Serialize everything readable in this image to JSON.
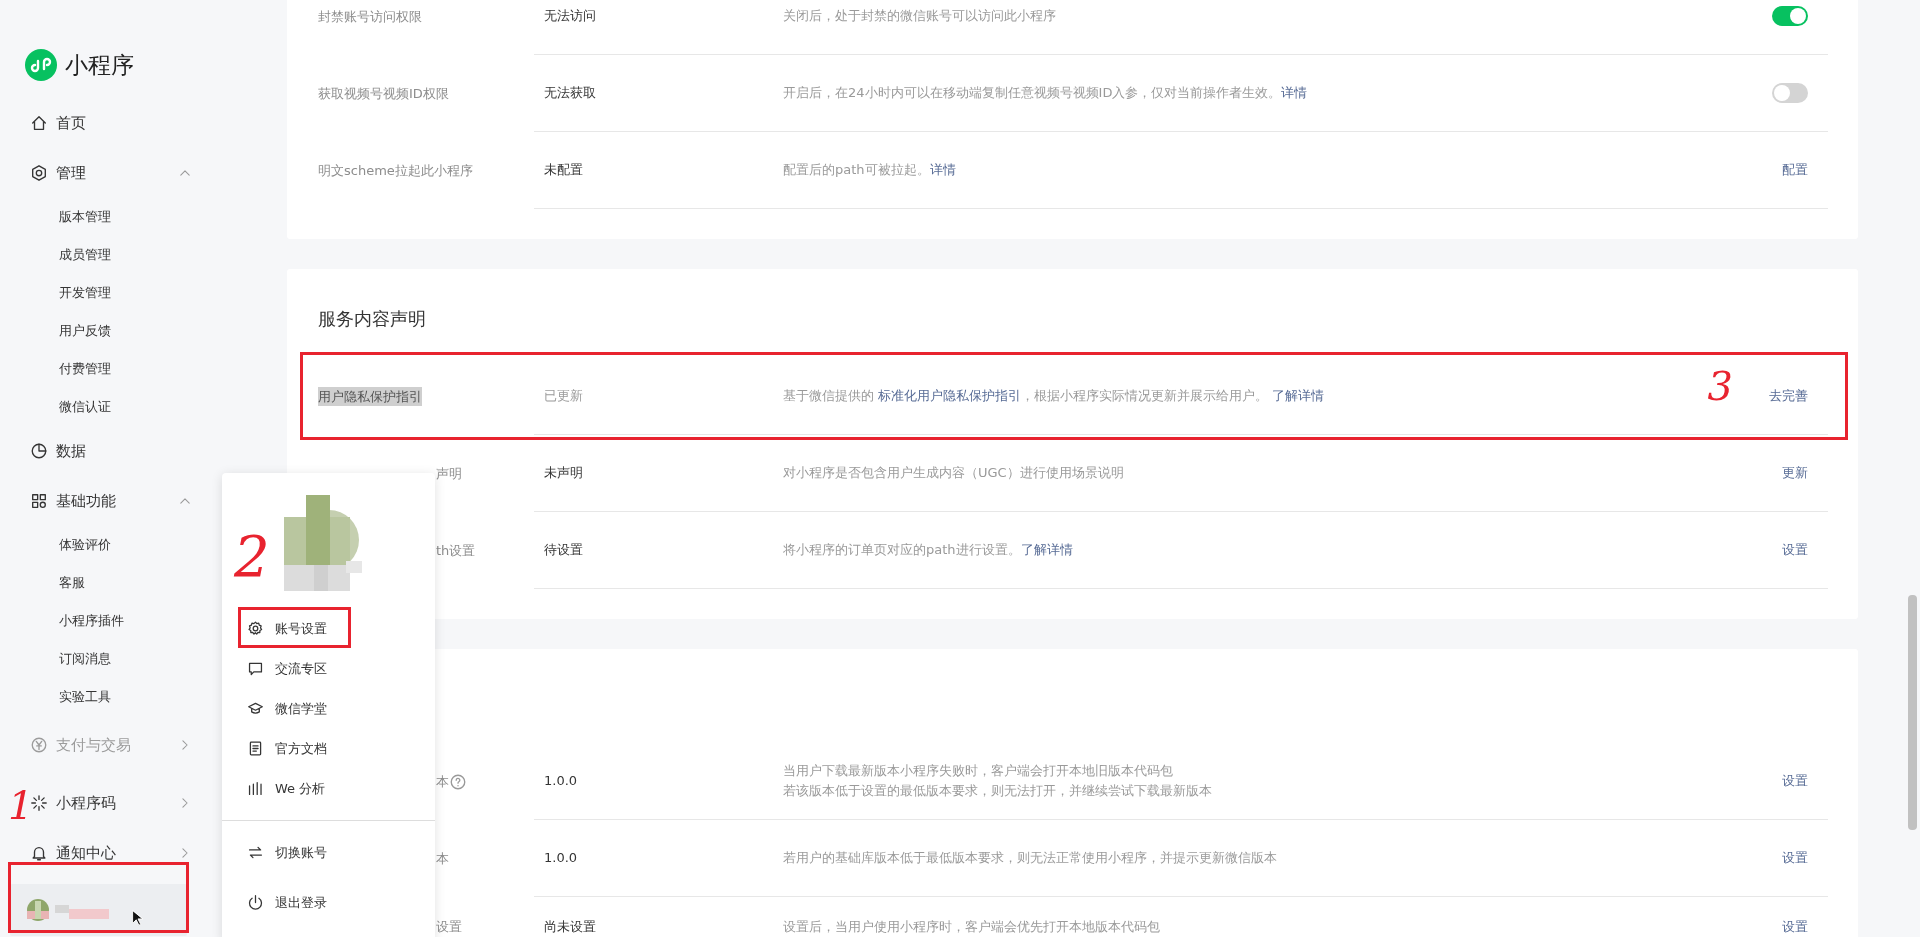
{
  "sidebar": {
    "logo": "小程序",
    "items": [
      {
        "label": "首页"
      },
      {
        "label": "管理",
        "expanded": true,
        "children": [
          {
            "label": "版本管理"
          },
          {
            "label": "成员管理"
          },
          {
            "label": "开发管理"
          },
          {
            "label": "用户反馈"
          },
          {
            "label": "付费管理"
          },
          {
            "label": "微信认证"
          }
        ]
      },
      {
        "label": "数据"
      },
      {
        "label": "基础功能",
        "expanded": true,
        "children": [
          {
            "label": "体验评价"
          },
          {
            "label": "客服"
          },
          {
            "label": "小程序插件"
          },
          {
            "label": "订阅消息"
          },
          {
            "label": "实验工具"
          }
        ]
      },
      {
        "label": "支付与交易",
        "expanded": false,
        "disabled": true
      },
      {
        "label": "小程序码",
        "expanded": false,
        "disabled": false
      },
      {
        "label": "通知中心",
        "expanded": false,
        "disabled": false
      }
    ],
    "account": {
      "annotation": "1"
    }
  },
  "cards": [
    {
      "rows": [
        {
          "label": "封禁账号访问权限",
          "value": "无法访问",
          "desc": [
            {
              "text": "关闭后，处于封禁的微信账号可以访问此小程序"
            }
          ],
          "kind": "toggle",
          "on": true
        },
        {
          "label": "获取视频号视频ID权限",
          "value": "无法获取",
          "desc": [
            {
              "text": "开启后，在24小时内可以在移动端复制任意视频号视频ID入参，仅对当前操作者生效。"
            },
            {
              "link": "详情"
            }
          ],
          "kind": "toggle",
          "on": false
        },
        {
          "label": "明文scheme拉起此小程序",
          "value": "未配置",
          "desc": [
            {
              "text": "配置后的path可被拉起。"
            },
            {
              "link": "详情"
            }
          ],
          "kind": "action",
          "action": "配置"
        }
      ]
    },
    {
      "title": "服务内容声明",
      "rows": [
        {
          "label": "用户隐私保护指引",
          "highlighted": true,
          "value": "已更新",
          "muted": true,
          "desc": [
            {
              "text": "基于微信提供的 "
            },
            {
              "link": "标准化用户隐私保护指引"
            },
            {
              "text": "，根据小程序实际情况更新并展示给用户。 "
            },
            {
              "link": "了解详情"
            }
          ],
          "kind": "action",
          "action": "去完善",
          "annotation": "3"
        },
        {
          "label": "声明",
          "covered": true,
          "value": "未声明",
          "desc": [
            {
              "text": "对小程序是否包含用户生成内容（UGC）进行使用场景说明"
            }
          ],
          "kind": "action",
          "action": "更新"
        },
        {
          "label": "th设置",
          "covered": true,
          "value": "待设置",
          "desc": [
            {
              "text": "将小程序的订单页对应的path进行设置。"
            },
            {
              "link": "了解详情"
            }
          ],
          "kind": "action",
          "action": "设置"
        }
      ]
    },
    {
      "rows": [
        {
          "label": "本",
          "covered": true,
          "help": true,
          "value": "1.0.0",
          "desc": [
            {
              "text": "当用户下载最新版本小程序失败时，客户端会打开本地旧版本代码包"
            }
          ],
          "desc_line_2": [
            {
              "text": "若该版本低于设置的最低版本要求，则无法打开，并继续尝试下载最新版本"
            }
          ],
          "kind": "action",
          "action": "设置"
        },
        {
          "label": "本",
          "covered": true,
          "value": "1.0.0",
          "desc": [
            {
              "text": "若用户的基础库版本低于最低版本要求，则无法正常使用小程序，并提示更新微信版本"
            }
          ],
          "kind": "action",
          "action": "设置"
        },
        {
          "label": "设置",
          "covered": true,
          "value": "尚未设置",
          "desc": [
            {
              "text": "设置后，当用户使用小程序时，客户端会优先打开本地版本代码包"
            }
          ],
          "kind": "action",
          "action": "设置"
        }
      ]
    }
  ],
  "account_menu": {
    "items": [
      {
        "label": "账号设置",
        "annotation": "2"
      },
      {
        "label": "交流专区"
      },
      {
        "label": "微信学堂"
      },
      {
        "label": "官方文档"
      },
      {
        "label": "We 分析"
      }
    ],
    "footer_items": [
      {
        "label": "切换账号"
      },
      {
        "label": "退出登录"
      }
    ]
  }
}
